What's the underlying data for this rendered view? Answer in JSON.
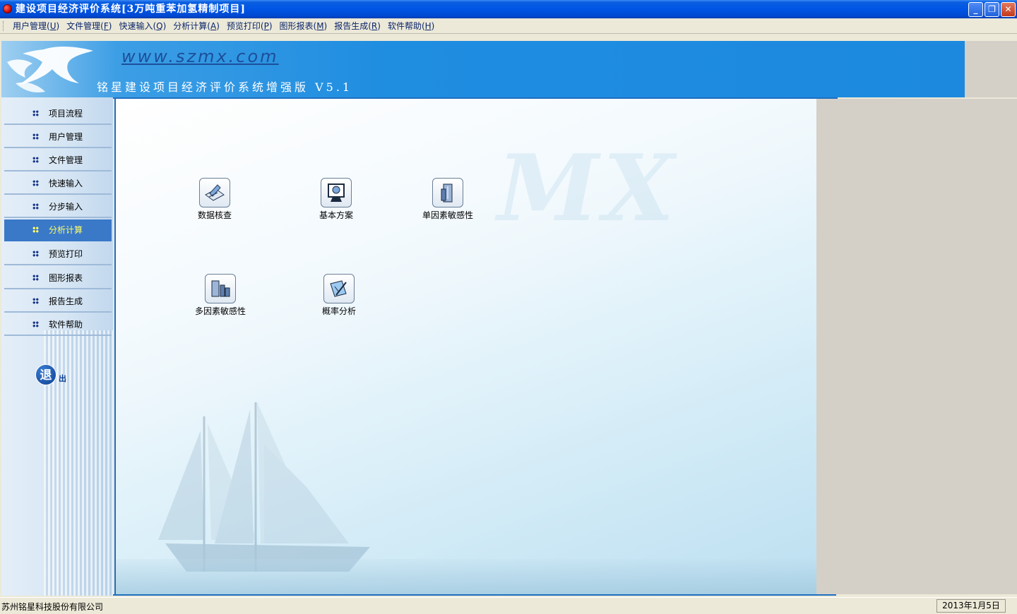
{
  "window": {
    "title": "建设项目经济评价系统[3万吨重苯加氢精制项目]",
    "minimize_label": "_",
    "restore_label": "❐",
    "close_label": "✕"
  },
  "menu": [
    {
      "label": "用户管理(",
      "key": "U",
      "end": ")"
    },
    {
      "label": "文件管理(",
      "key": "F",
      "end": ")"
    },
    {
      "label": "快速输入(",
      "key": "Q",
      "end": ")"
    },
    {
      "label": "分析计算(",
      "key": "A",
      "end": ")"
    },
    {
      "label": "预览打印(",
      "key": "P",
      "end": ")"
    },
    {
      "label": "图形报表(",
      "key": "M",
      "end": ")"
    },
    {
      "label": "报告生成(",
      "key": "R",
      "end": ")"
    },
    {
      "label": "软件帮助(",
      "key": "H",
      "end": ")"
    }
  ],
  "banner": {
    "url": "www.szmx.com",
    "product": "铭星建设项目经济评价系统增强版 V5.1"
  },
  "sidebar": {
    "items": [
      {
        "label": "项目流程",
        "active": false
      },
      {
        "label": "用户管理",
        "active": false
      },
      {
        "label": "文件管理",
        "active": false
      },
      {
        "label": "快速输入",
        "active": false
      },
      {
        "label": "分步输入",
        "active": false
      },
      {
        "label": "分析计算",
        "active": true
      },
      {
        "label": "预览打印",
        "active": false
      },
      {
        "label": "图形报表",
        "active": false
      },
      {
        "label": "报告生成",
        "active": false
      },
      {
        "label": "软件帮助",
        "active": false
      }
    ],
    "exit_main": "退",
    "exit_sub": "出"
  },
  "main": {
    "watermark": "MX",
    "tools": [
      {
        "label": "数据核查",
        "icon": "data-check-icon"
      },
      {
        "label": "基本方案",
        "icon": "basic-plan-icon"
      },
      {
        "label": "单因素敏感性",
        "icon": "single-factor-icon"
      },
      {
        "label": "多因素敏感性",
        "icon": "multi-factor-icon"
      },
      {
        "label": "概率分析",
        "icon": "probability-icon"
      }
    ]
  },
  "status": {
    "company": "苏州铭星科技股份有限公司",
    "date": "2013年1月5日"
  },
  "colors": {
    "title_bar": "#0055e5",
    "active_nav": "#3a78c8",
    "active_nav_text": "#ffff66",
    "banner": "#1c89df"
  }
}
